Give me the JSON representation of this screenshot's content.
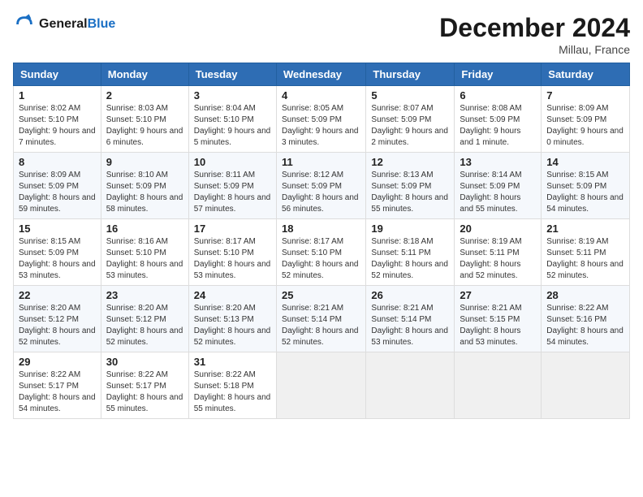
{
  "header": {
    "logo_line1": "General",
    "logo_line2": "Blue",
    "month": "December 2024",
    "location": "Millau, France"
  },
  "columns": [
    "Sunday",
    "Monday",
    "Tuesday",
    "Wednesday",
    "Thursday",
    "Friday",
    "Saturday"
  ],
  "weeks": [
    [
      {
        "day": "1",
        "text": "Sunrise: 8:02 AM\nSunset: 5:10 PM\nDaylight: 9 hours and 7 minutes."
      },
      {
        "day": "2",
        "text": "Sunrise: 8:03 AM\nSunset: 5:10 PM\nDaylight: 9 hours and 6 minutes."
      },
      {
        "day": "3",
        "text": "Sunrise: 8:04 AM\nSunset: 5:10 PM\nDaylight: 9 hours and 5 minutes."
      },
      {
        "day": "4",
        "text": "Sunrise: 8:05 AM\nSunset: 5:09 PM\nDaylight: 9 hours and 3 minutes."
      },
      {
        "day": "5",
        "text": "Sunrise: 8:07 AM\nSunset: 5:09 PM\nDaylight: 9 hours and 2 minutes."
      },
      {
        "day": "6",
        "text": "Sunrise: 8:08 AM\nSunset: 5:09 PM\nDaylight: 9 hours and 1 minute."
      },
      {
        "day": "7",
        "text": "Sunrise: 8:09 AM\nSunset: 5:09 PM\nDaylight: 9 hours and 0 minutes."
      }
    ],
    [
      {
        "day": "8",
        "text": "Sunrise: 8:09 AM\nSunset: 5:09 PM\nDaylight: 8 hours and 59 minutes."
      },
      {
        "day": "9",
        "text": "Sunrise: 8:10 AM\nSunset: 5:09 PM\nDaylight: 8 hours and 58 minutes."
      },
      {
        "day": "10",
        "text": "Sunrise: 8:11 AM\nSunset: 5:09 PM\nDaylight: 8 hours and 57 minutes."
      },
      {
        "day": "11",
        "text": "Sunrise: 8:12 AM\nSunset: 5:09 PM\nDaylight: 8 hours and 56 minutes."
      },
      {
        "day": "12",
        "text": "Sunrise: 8:13 AM\nSunset: 5:09 PM\nDaylight: 8 hours and 55 minutes."
      },
      {
        "day": "13",
        "text": "Sunrise: 8:14 AM\nSunset: 5:09 PM\nDaylight: 8 hours and 55 minutes."
      },
      {
        "day": "14",
        "text": "Sunrise: 8:15 AM\nSunset: 5:09 PM\nDaylight: 8 hours and 54 minutes."
      }
    ],
    [
      {
        "day": "15",
        "text": "Sunrise: 8:15 AM\nSunset: 5:09 PM\nDaylight: 8 hours and 53 minutes."
      },
      {
        "day": "16",
        "text": "Sunrise: 8:16 AM\nSunset: 5:10 PM\nDaylight: 8 hours and 53 minutes."
      },
      {
        "day": "17",
        "text": "Sunrise: 8:17 AM\nSunset: 5:10 PM\nDaylight: 8 hours and 53 minutes."
      },
      {
        "day": "18",
        "text": "Sunrise: 8:17 AM\nSunset: 5:10 PM\nDaylight: 8 hours and 52 minutes."
      },
      {
        "day": "19",
        "text": "Sunrise: 8:18 AM\nSunset: 5:11 PM\nDaylight: 8 hours and 52 minutes."
      },
      {
        "day": "20",
        "text": "Sunrise: 8:19 AM\nSunset: 5:11 PM\nDaylight: 8 hours and 52 minutes."
      },
      {
        "day": "21",
        "text": "Sunrise: 8:19 AM\nSunset: 5:11 PM\nDaylight: 8 hours and 52 minutes."
      }
    ],
    [
      {
        "day": "22",
        "text": "Sunrise: 8:20 AM\nSunset: 5:12 PM\nDaylight: 8 hours and 52 minutes."
      },
      {
        "day": "23",
        "text": "Sunrise: 8:20 AM\nSunset: 5:12 PM\nDaylight: 8 hours and 52 minutes."
      },
      {
        "day": "24",
        "text": "Sunrise: 8:20 AM\nSunset: 5:13 PM\nDaylight: 8 hours and 52 minutes."
      },
      {
        "day": "25",
        "text": "Sunrise: 8:21 AM\nSunset: 5:14 PM\nDaylight: 8 hours and 52 minutes."
      },
      {
        "day": "26",
        "text": "Sunrise: 8:21 AM\nSunset: 5:14 PM\nDaylight: 8 hours and 53 minutes."
      },
      {
        "day": "27",
        "text": "Sunrise: 8:21 AM\nSunset: 5:15 PM\nDaylight: 8 hours and 53 minutes."
      },
      {
        "day": "28",
        "text": "Sunrise: 8:22 AM\nSunset: 5:16 PM\nDaylight: 8 hours and 54 minutes."
      }
    ],
    [
      {
        "day": "29",
        "text": "Sunrise: 8:22 AM\nSunset: 5:17 PM\nDaylight: 8 hours and 54 minutes."
      },
      {
        "day": "30",
        "text": "Sunrise: 8:22 AM\nSunset: 5:17 PM\nDaylight: 8 hours and 55 minutes."
      },
      {
        "day": "31",
        "text": "Sunrise: 8:22 AM\nSunset: 5:18 PM\nDaylight: 8 hours and 55 minutes."
      },
      null,
      null,
      null,
      null
    ]
  ]
}
